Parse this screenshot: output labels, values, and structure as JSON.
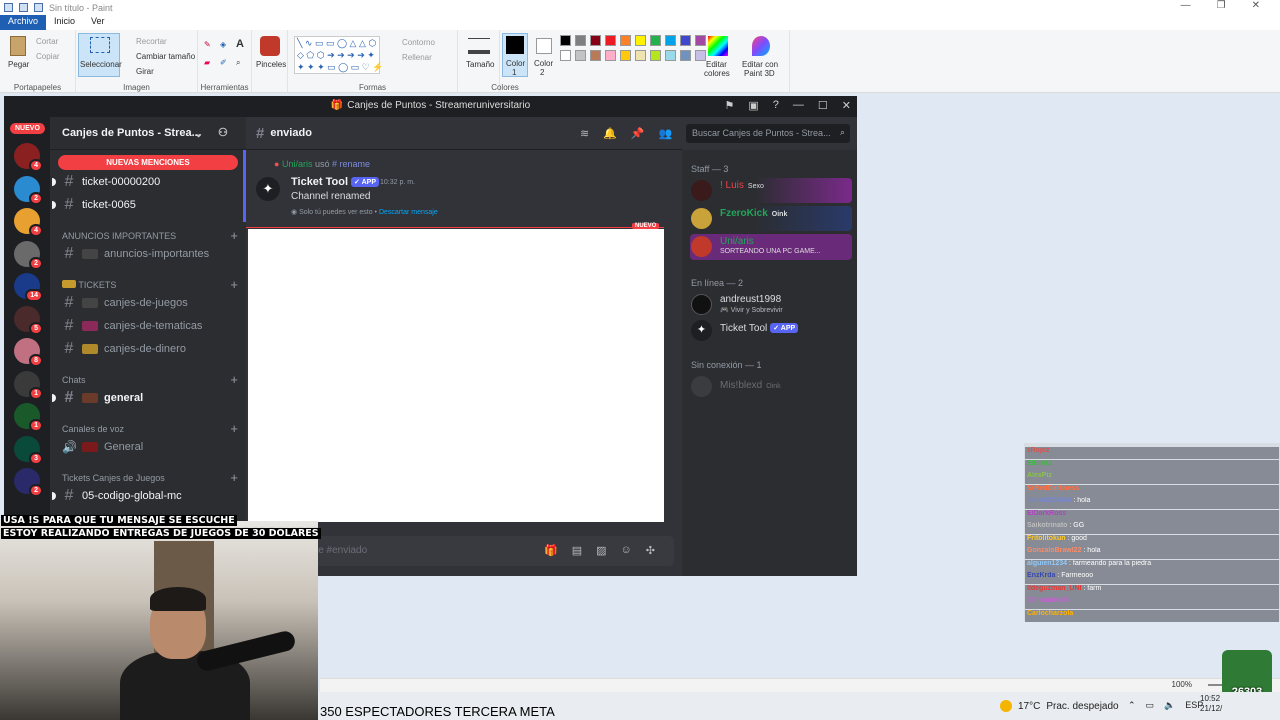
{
  "paint": {
    "title": "Sin título - Paint",
    "tabs": [
      "Archivo",
      "Inicio",
      "Ver"
    ],
    "groups": {
      "portapapeles": {
        "label": "Portapapeles",
        "pegar": "Pegar",
        "cortar": "Cortar",
        "copiar": "Copiar"
      },
      "imagen": {
        "label": "Imagen",
        "seleccionar": "Seleccionar",
        "recortar": "Recortar",
        "cambiar": "Cambiar tamaño",
        "girar": "Girar"
      },
      "herramientas": {
        "label": "Herramientas"
      },
      "pinceles": {
        "label": "Pinceles"
      },
      "formas": {
        "label": "Formas",
        "contorno": "Contorno",
        "rellenar": "Rellenar"
      },
      "tamano": {
        "label": "Tamaño"
      },
      "colores": {
        "label": "Colores",
        "color1": "Color",
        "color1b": "1",
        "color2": "Color",
        "color2b": "2",
        "editar": "Editar",
        "editar2": "colores",
        "paint3d": "Editar con",
        "paint3d2": "Paint 3D"
      }
    },
    "palette": [
      "#000000",
      "#7f7f7f",
      "#880015",
      "#ed1c24",
      "#ff7f27",
      "#fff200",
      "#22b14c",
      "#00a2e8",
      "#3f48cc",
      "#a349a4",
      "#ffffff",
      "#c3c3c3",
      "#b97a57",
      "#ffaec9",
      "#ffc90e",
      "#efe4b0",
      "#b5e61d",
      "#99d9ea",
      "#7092be",
      "#c8bfe7"
    ],
    "zoom": "100%"
  },
  "discord": {
    "window_title": "Canjes de Puntos - Streameruniversitario",
    "nuevo": "NUEVO",
    "server_badges": [
      "4",
      "2",
      "4",
      "2",
      "14",
      "5",
      "8",
      "1",
      "1",
      "3",
      "2"
    ],
    "server_name": "Canjes de Puntos - Strea...",
    "new_mentions": "NUEVAS MENCIONES",
    "channels": {
      "ticket1": "ticket-00000200",
      "ticket2": "ticket-0065",
      "cat_anuncios": "ANUNCIOS IMPORTANTES",
      "anuncios": "anuncios-importantes",
      "cat_tickets": "TICKETS",
      "juegos": "canjes-de-juegos",
      "tematicas": "canjes-de-tematicas",
      "dinero": "canjes-de-dinero",
      "cat_chats": "Chats",
      "general": "general",
      "cat_voz": "Canales de voz",
      "voz_general": "General",
      "cat_tickets_juegos": "Tickets Canjes de Juegos",
      "codigo": "05-codigo-global-mc"
    },
    "chat": {
      "channel": "enviado",
      "search_placeholder": "Buscar Canjes de Puntos - Strea...",
      "reply_user": "Uni/aris",
      "reply_used": "usó",
      "reply_cmd": "# rename",
      "author": "Ticket Tool",
      "app_badge": "✓ APP",
      "time": "10:32 p. m.",
      "text": "Channel renamed",
      "note": "Solo tú puedes ver esto •",
      "dismiss": "Descartar mensaje",
      "nuevo_tag": "NUEVO",
      "composer": "je #enviado"
    },
    "members": {
      "staff_header": "Staff — 3",
      "m1_name": "! Luis",
      "m1_extra": "Sexo",
      "m2_name": "FzeroKick",
      "m2_extra": "Oink",
      "m3_name": "Uni/aris",
      "m3_status": "SORTEANDO UNA PC GAME...",
      "online_header": "En línea — 2",
      "m4_name": "andreust1998",
      "m4_status": "Vivir y Sobrevivir",
      "m5_name": "Ticket Tool",
      "m5_badge": "✓ APP",
      "offline_header": "Sin conexión — 1",
      "m6_name": "Mis!blexd",
      "m6_extra": "Oink"
    }
  },
  "stream": {
    "announcement1": "USA !S PARA QUE TU MENSAJE SE ESCUCHE",
    "announcement2": "ESTOY REALIZANDO ENTREGAS DE JUEGOS DE 30 DOLARES",
    "ticker": "350 ESPECTADORES TERCERA META",
    "goal_count": "26303",
    "chat_lines": [
      {
        "user": "zRojoz",
        "msg": ""
      },
      {
        "user": "ElBrut1",
        "msg": ""
      },
      {
        "user": "AlexPiz",
        "msg": ""
      },
      {
        "user": "SrRedDarkness",
        "msg": ""
      },
      {
        "user": "Jairo822466b",
        "msg": ": hola"
      },
      {
        "user": "ElDarkRoss",
        "msg": ""
      },
      {
        "user": "Saikotrinato",
        "msg": ": GG"
      },
      {
        "user": "Fritolitokun",
        "msg": ": good"
      },
      {
        "user": "GonzaloBrawl22",
        "msg": ": hola"
      },
      {
        "user": "alguien1234",
        "msg": ": farmeando para la piedra"
      },
      {
        "user": "EnzKrda",
        "msg": ": Farmeooo"
      },
      {
        "user": "lldeguzman_UNI",
        "msg": ": farm"
      },
      {
        "user": "Chromilex03",
        "msg": ""
      },
      {
        "user": "Carlocharzola",
        "msg": ""
      }
    ]
  },
  "taskbar": {
    "temp": "17°C",
    "weather": "Prac. despejado",
    "lang": "ESP",
    "time": "10:52",
    "date": "21/12/"
  }
}
